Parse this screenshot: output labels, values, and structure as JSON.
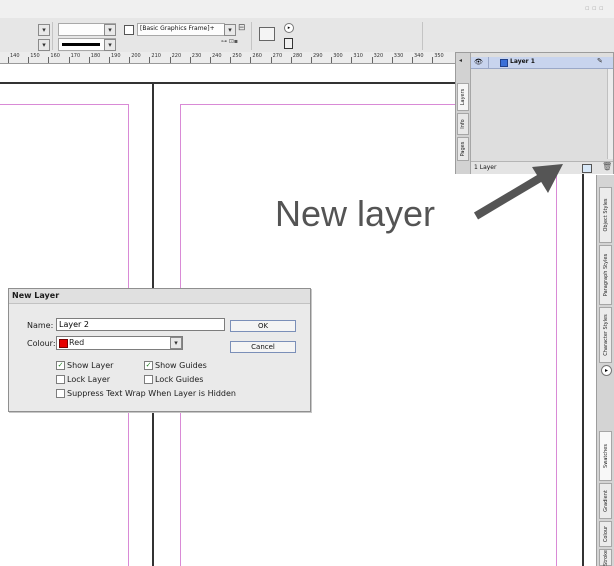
{
  "control_bar": {
    "frame_style_value": "[Basic Graphics Frame]+"
  },
  "ruler": {
    "ticks": [
      "140",
      "150",
      "160",
      "170",
      "180",
      "190",
      "200",
      "210",
      "220",
      "230",
      "240",
      "250",
      "260",
      "270",
      "280",
      "290",
      "300",
      "310",
      "320",
      "330",
      "340",
      "350"
    ]
  },
  "layers_panel": {
    "tabs": [
      "Layers",
      "Info",
      "Pages"
    ],
    "layer_name": "Layer 1",
    "footer_count": "1 Layer"
  },
  "right_dock": {
    "tabs": [
      "Object Styles",
      "Paragraph Styles",
      "Character Styles",
      "Swatches",
      "Gradient",
      "Colour",
      "Stroke"
    ]
  },
  "annotation": {
    "text": "New layer"
  },
  "dialog": {
    "title": "New Layer",
    "name_label": "Name:",
    "name_value": "Layer 2",
    "colour_label": "Colour:",
    "colour_value": "Red",
    "colour_swatch": "#e60000",
    "ok_label": "OK",
    "cancel_label": "Cancel",
    "show_layer_label": "Show Layer",
    "show_layer_checked": true,
    "show_guides_label": "Show Guides",
    "show_guides_checked": true,
    "lock_layer_label": "Lock Layer",
    "lock_layer_checked": false,
    "lock_guides_label": "Lock Guides",
    "lock_guides_checked": false,
    "suppress_wrap_label": "Suppress Text Wrap When Layer is Hidden",
    "suppress_wrap_checked": false
  },
  "colors": {
    "margin_guide": "#d98ad6",
    "arrow": "#555555",
    "selected_layer": "#c8d4ee"
  }
}
